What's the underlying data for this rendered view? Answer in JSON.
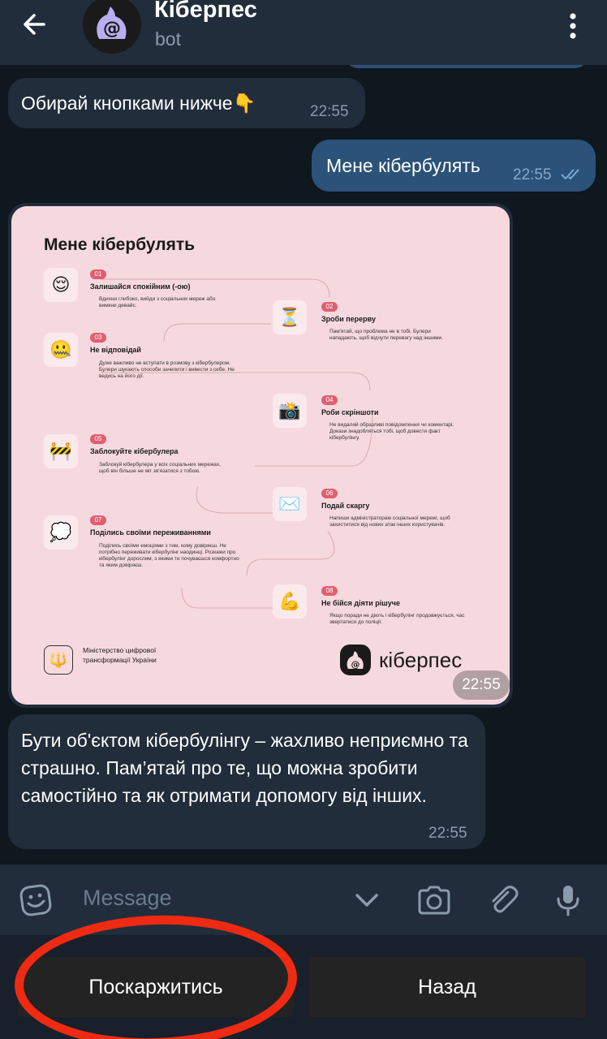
{
  "header": {
    "title": "Кіберпес",
    "subtitle": "bot"
  },
  "messages": {
    "m1": {
      "text": "Обирай кнопками нижче👇",
      "time": "22:55"
    },
    "m2": {
      "text": "Мене кібербулять",
      "time": "22:55"
    },
    "m3": {
      "time": "22:55"
    },
    "m4": {
      "text": "Бути об'єктом кібербулінгу – жахливо неприємно та страшно. Пам’ятай про те, що можна зробити самостійно та як отримати допомогу від інших.",
      "time": "22:55"
    }
  },
  "infographic": {
    "title": "Мене кібербулять",
    "steps": [
      {
        "num": "01",
        "emoji": "😌",
        "title": "Залишайся спокійним (-ою)",
        "desc": "Вдихни глибоко, вийди з соціальних мереж або вимкни девайс."
      },
      {
        "num": "02",
        "emoji": "⏳",
        "title": "Зроби перерву",
        "desc": "Пам'ятай, що проблема не в тобі. Булери нападають, щоб відчути перевагу над іншими."
      },
      {
        "num": "03",
        "emoji": "🤐",
        "title": "Не відповідай",
        "desc": "Дуже важливо не вступати в розмову з кібербулером. Булери шукають способи зачепити і вивести з себе. Не ведись на його дії."
      },
      {
        "num": "04",
        "emoji": "📸",
        "title": "Роби скріншоти",
        "desc": "Не видаляй образливі повідомлення чи коментарі. Докази знадобляться тобі, щоб довести факт кібербулінгу."
      },
      {
        "num": "05",
        "emoji": "🚧",
        "title": "Заблокуйте кібербулера",
        "desc": "Заблокуй кібербулера у всіх соціальних мережах, щоб він більше не міг зв'язатися з тобою."
      },
      {
        "num": "06",
        "emoji": "✉️",
        "title": "Подай скаргу",
        "desc": "Напиши адміністраторам соціальної мережі, щоб захиститися від нових атак інших користувачів."
      },
      {
        "num": "07",
        "emoji": "💭",
        "title": "Поділись своїми переживаннями",
        "desc": "Поділись своїми емоціями з тим, кому довіряєш. Не потрібно переживати кібербулінг наодинці. Розкажи про кібербулінг дорослим, з якими ти почуваєшся комфортно та яким довіряєш."
      },
      {
        "num": "08",
        "emoji": "💪",
        "title": "Не бійся діяти рішуче",
        "desc": "Якщо поради не діють і кібербулінг продовжується, час звертатися до поліції."
      }
    ],
    "ministry": "Міністерство цифрової трансформації України",
    "brand": "кіберпес",
    "trident": "🔱"
  },
  "input": {
    "placeholder": "Message"
  },
  "keyboard": {
    "button1": "Поскаржитись",
    "button2": "Назад"
  },
  "icons": {
    "back": "back-arrow-icon",
    "menu": "more-vertical-icon",
    "emoji": "emoji-icon",
    "collapse": "chevron-down-icon",
    "camera": "camera-icon",
    "attach": "paperclip-icon",
    "mic": "microphone-icon"
  },
  "colors": {
    "header_bg": "#212d3b",
    "chat_bg": "#0f171f",
    "incoming_bubble": "#212d3b",
    "outgoing_bubble": "#2b5278",
    "annotation": "#ee2a13",
    "infographic_bg": "#f6d9de",
    "step_number": "#e15e70"
  }
}
